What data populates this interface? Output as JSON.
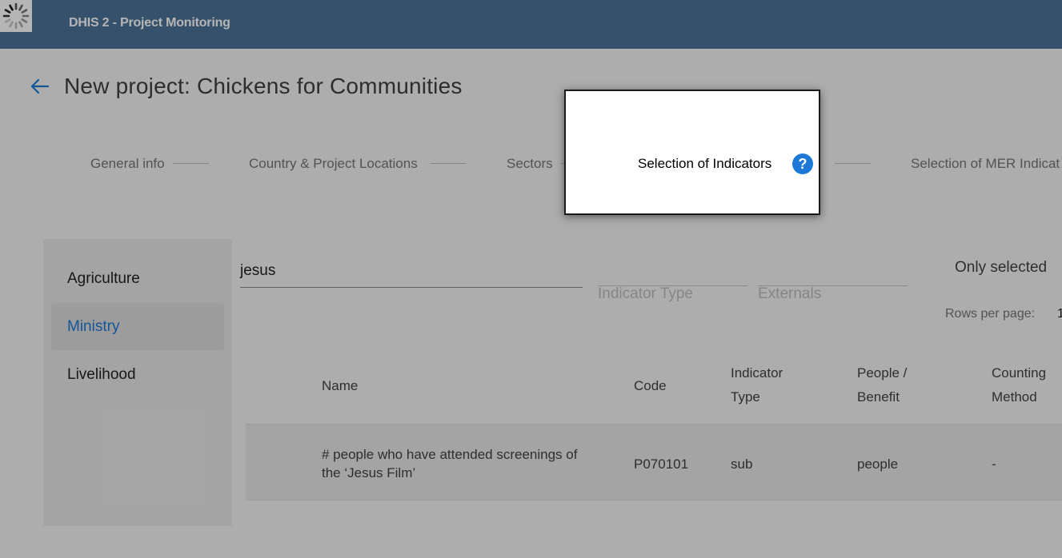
{
  "header": {
    "app_title": "DHIS 2 - Project Monitoring",
    "logo_icon": "loading-spinner-icon"
  },
  "page": {
    "title": "New project: Chickens for Communities",
    "back_icon": "arrow-left-icon"
  },
  "stepper": {
    "steps": [
      {
        "label": "General info"
      },
      {
        "label": "Country & Project Locations"
      },
      {
        "label": "Sectors"
      },
      {
        "label": "Selection of Indicators"
      },
      {
        "label": "Selection of MER Indicat"
      }
    ],
    "active_index": 3,
    "help_icon": "help-circle-icon",
    "help_glyph": "?"
  },
  "sidebar": {
    "items": [
      {
        "label": "Agriculture",
        "active": false
      },
      {
        "label": "Ministry",
        "active": true
      },
      {
        "label": "Livelihood",
        "active": false
      }
    ]
  },
  "filters": {
    "search_value": "jesus",
    "indicator_type_placeholder": "Indicator Type",
    "externals_placeholder": "Externals",
    "only_selected_label": "Only selected",
    "rows_per_page_label": "Rows per page:",
    "rows_per_page_value": "1"
  },
  "table": {
    "columns": [
      [
        "Name"
      ],
      [
        "Code"
      ],
      [
        "Indicator",
        "Type"
      ],
      [
        "People /",
        "Benefit"
      ],
      [
        "Counting",
        "Method"
      ]
    ],
    "rows": [
      {
        "name_lines": [
          "# people who have attended screenings of",
          "the ‘Jesus Film’"
        ],
        "code": "P070101",
        "indicator_type": "sub",
        "people_benefit": "people",
        "counting_method": "-"
      }
    ]
  },
  "colors": {
    "header_bg": "#4d7297",
    "accent_blue": "#1e78d6",
    "active_sidebar_text": "#1e78d6",
    "overlay": "rgba(0,0,0,0.29)"
  }
}
